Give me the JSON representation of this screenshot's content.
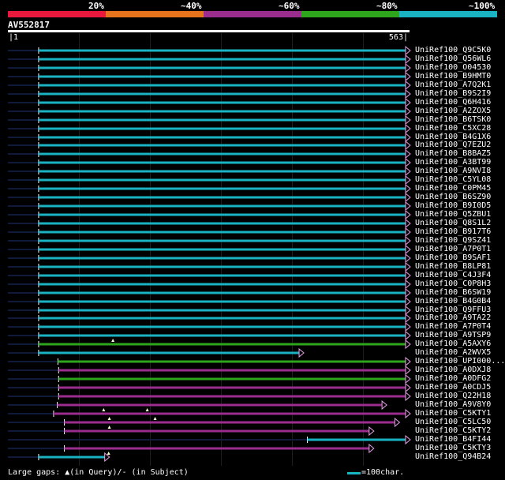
{
  "legend": [
    {
      "label": "20%",
      "color": "#e8193c"
    },
    {
      "label": "~40%",
      "color": "#e5741d"
    },
    {
      "label": "~60%",
      "color": "#9b2d8f"
    },
    {
      "label": "~80%",
      "color": "#2fa51e"
    },
    {
      "label": "~100%",
      "color": "#1ab3c4"
    }
  ],
  "query": {
    "name": "AV552817",
    "start": "|1",
    "end": "563|",
    "length": 563
  },
  "hits": [
    {
      "label": "UniRef100_Q9C5K0",
      "from": 44,
      "to": 563,
      "color": "#1ab3c4"
    },
    {
      "label": "UniRef100_Q56WL6",
      "from": 44,
      "to": 563,
      "color": "#1ab3c4"
    },
    {
      "label": "UniRef100_O04530",
      "from": 44,
      "to": 563,
      "color": "#1ab3c4"
    },
    {
      "label": "UniRef100_B9HMT0",
      "from": 44,
      "to": 563,
      "color": "#1ab3c4"
    },
    {
      "label": "UniRef100_A7Q2K1",
      "from": 44,
      "to": 563,
      "color": "#1ab3c4"
    },
    {
      "label": "UniRef100_B9S2I9",
      "from": 44,
      "to": 563,
      "color": "#1ab3c4"
    },
    {
      "label": "UniRef100_Q6H416",
      "from": 44,
      "to": 563,
      "color": "#1ab3c4"
    },
    {
      "label": "UniRef100_A2ZOX5",
      "from": 44,
      "to": 563,
      "color": "#1ab3c4"
    },
    {
      "label": "UniRef100_B6TSK0",
      "from": 44,
      "to": 563,
      "color": "#1ab3c4"
    },
    {
      "label": "UniRef100_C5XC28",
      "from": 44,
      "to": 563,
      "color": "#1ab3c4"
    },
    {
      "label": "UniRef100_B4G1X6",
      "from": 44,
      "to": 563,
      "color": "#1ab3c4"
    },
    {
      "label": "UniRef100_Q7EZU2",
      "from": 44,
      "to": 563,
      "color": "#1ab3c4"
    },
    {
      "label": "UniRef100_B8BAZ5",
      "from": 44,
      "to": 563,
      "color": "#1ab3c4"
    },
    {
      "label": "UniRef100_A3BT99",
      "from": 44,
      "to": 563,
      "color": "#1ab3c4"
    },
    {
      "label": "UniRef100_A9NVI8",
      "from": 44,
      "to": 563,
      "color": "#1ab3c4"
    },
    {
      "label": "UniRef100_C5YL08",
      "from": 44,
      "to": 563,
      "color": "#1ab3c4"
    },
    {
      "label": "UniRef100_C0PM45",
      "from": 44,
      "to": 563,
      "color": "#1ab3c4"
    },
    {
      "label": "UniRef100_B6SZ90",
      "from": 44,
      "to": 563,
      "color": "#1ab3c4"
    },
    {
      "label": "UniRef100_B9I0D5",
      "from": 44,
      "to": 563,
      "color": "#1ab3c4"
    },
    {
      "label": "UniRef100_Q5ZBU1",
      "from": 44,
      "to": 563,
      "color": "#1ab3c4"
    },
    {
      "label": "UniRef100_Q8S1L2",
      "from": 44,
      "to": 563,
      "color": "#1ab3c4"
    },
    {
      "label": "UniRef100_B917T6",
      "from": 44,
      "to": 563,
      "color": "#1ab3c4"
    },
    {
      "label": "UniRef100_Q9SZ41",
      "from": 44,
      "to": 563,
      "color": "#1ab3c4"
    },
    {
      "label": "UniRef100_A7P0T1",
      "from": 44,
      "to": 563,
      "color": "#1ab3c4"
    },
    {
      "label": "UniRef100_B9SAF1",
      "from": 44,
      "to": 563,
      "color": "#1ab3c4"
    },
    {
      "label": "UniRef100_B8LP81",
      "from": 44,
      "to": 563,
      "color": "#1ab3c4"
    },
    {
      "label": "UniRef100_C4J3F4",
      "from": 44,
      "to": 563,
      "color": "#1ab3c4"
    },
    {
      "label": "UniRef100_C0P8H3",
      "from": 44,
      "to": 563,
      "color": "#1ab3c4"
    },
    {
      "label": "UniRef100_B6SW19",
      "from": 44,
      "to": 563,
      "color": "#1ab3c4"
    },
    {
      "label": "UniRef100_B4G0B4",
      "from": 44,
      "to": 563,
      "color": "#1ab3c4"
    },
    {
      "label": "UniRef100_Q9FFU3",
      "from": 44,
      "to": 563,
      "color": "#1ab3c4"
    },
    {
      "label": "UniRef100_A9TA22",
      "from": 44,
      "to": 563,
      "color": "#1ab3c4"
    },
    {
      "label": "UniRef100_A7P0T4",
      "from": 44,
      "to": 563,
      "color": "#1ab3c4"
    },
    {
      "label": "UniRef100_A9TSP9",
      "from": 44,
      "to": 563,
      "color": "#1ab3c4"
    },
    {
      "label": "UniRef100_A5AXY6",
      "from": 44,
      "to": 563,
      "color": "#2fa51e",
      "gaps": [
        148
      ]
    },
    {
      "label": "UniRef100_A2WVX5",
      "from": 44,
      "to": 414,
      "color": "#1ab3c4"
    },
    {
      "label": "UniRef100_UPI000...",
      "from": 71,
      "to": 563,
      "color": "#2fa51e"
    },
    {
      "label": "UniRef100_A0DXJ8",
      "from": 72,
      "to": 563,
      "color": "#9b2d8f"
    },
    {
      "label": "UniRef100_A0DFG2",
      "from": 72,
      "to": 563,
      "color": "#2fa51e"
    },
    {
      "label": "UniRef100_A0CDJ5",
      "from": 72,
      "to": 563,
      "color": "#9b2d8f"
    },
    {
      "label": "UniRef100_Q22H18",
      "from": 72,
      "to": 563,
      "color": "#9b2d8f"
    },
    {
      "label": "UniRef100_A9V8Y0",
      "from": 70,
      "to": 530,
      "color": "#9b2d8f"
    },
    {
      "label": "UniRef100_C5KTY1",
      "from": 65,
      "to": 563,
      "color": "#9b2d8f",
      "gaps": [
        135,
        196
      ]
    },
    {
      "label": "UniRef100_C5LC50",
      "from": 80,
      "to": 548,
      "color": "#9b2d8f",
      "gaps": [
        143,
        207
      ]
    },
    {
      "label": "UniRef100_C5KTY2",
      "from": 80,
      "to": 512,
      "color": "#9b2d8f",
      "gaps": [
        143
      ]
    },
    {
      "label": "UniRef100_B4FI44",
      "from": 420,
      "to": 563,
      "color": "#1ab3c4"
    },
    {
      "label": "UniRef100_C5KTY3",
      "from": 80,
      "to": 512,
      "color": "#9b2d8f"
    },
    {
      "label": "UniRef100_Q94B24",
      "from": 44,
      "to": 142,
      "color": "#1ab3c4",
      "gaps": [
        142
      ]
    }
  ],
  "footer": {
    "text": "Large gaps: ▲(in Query)/- (in Subject)",
    "scale": "=100char."
  }
}
